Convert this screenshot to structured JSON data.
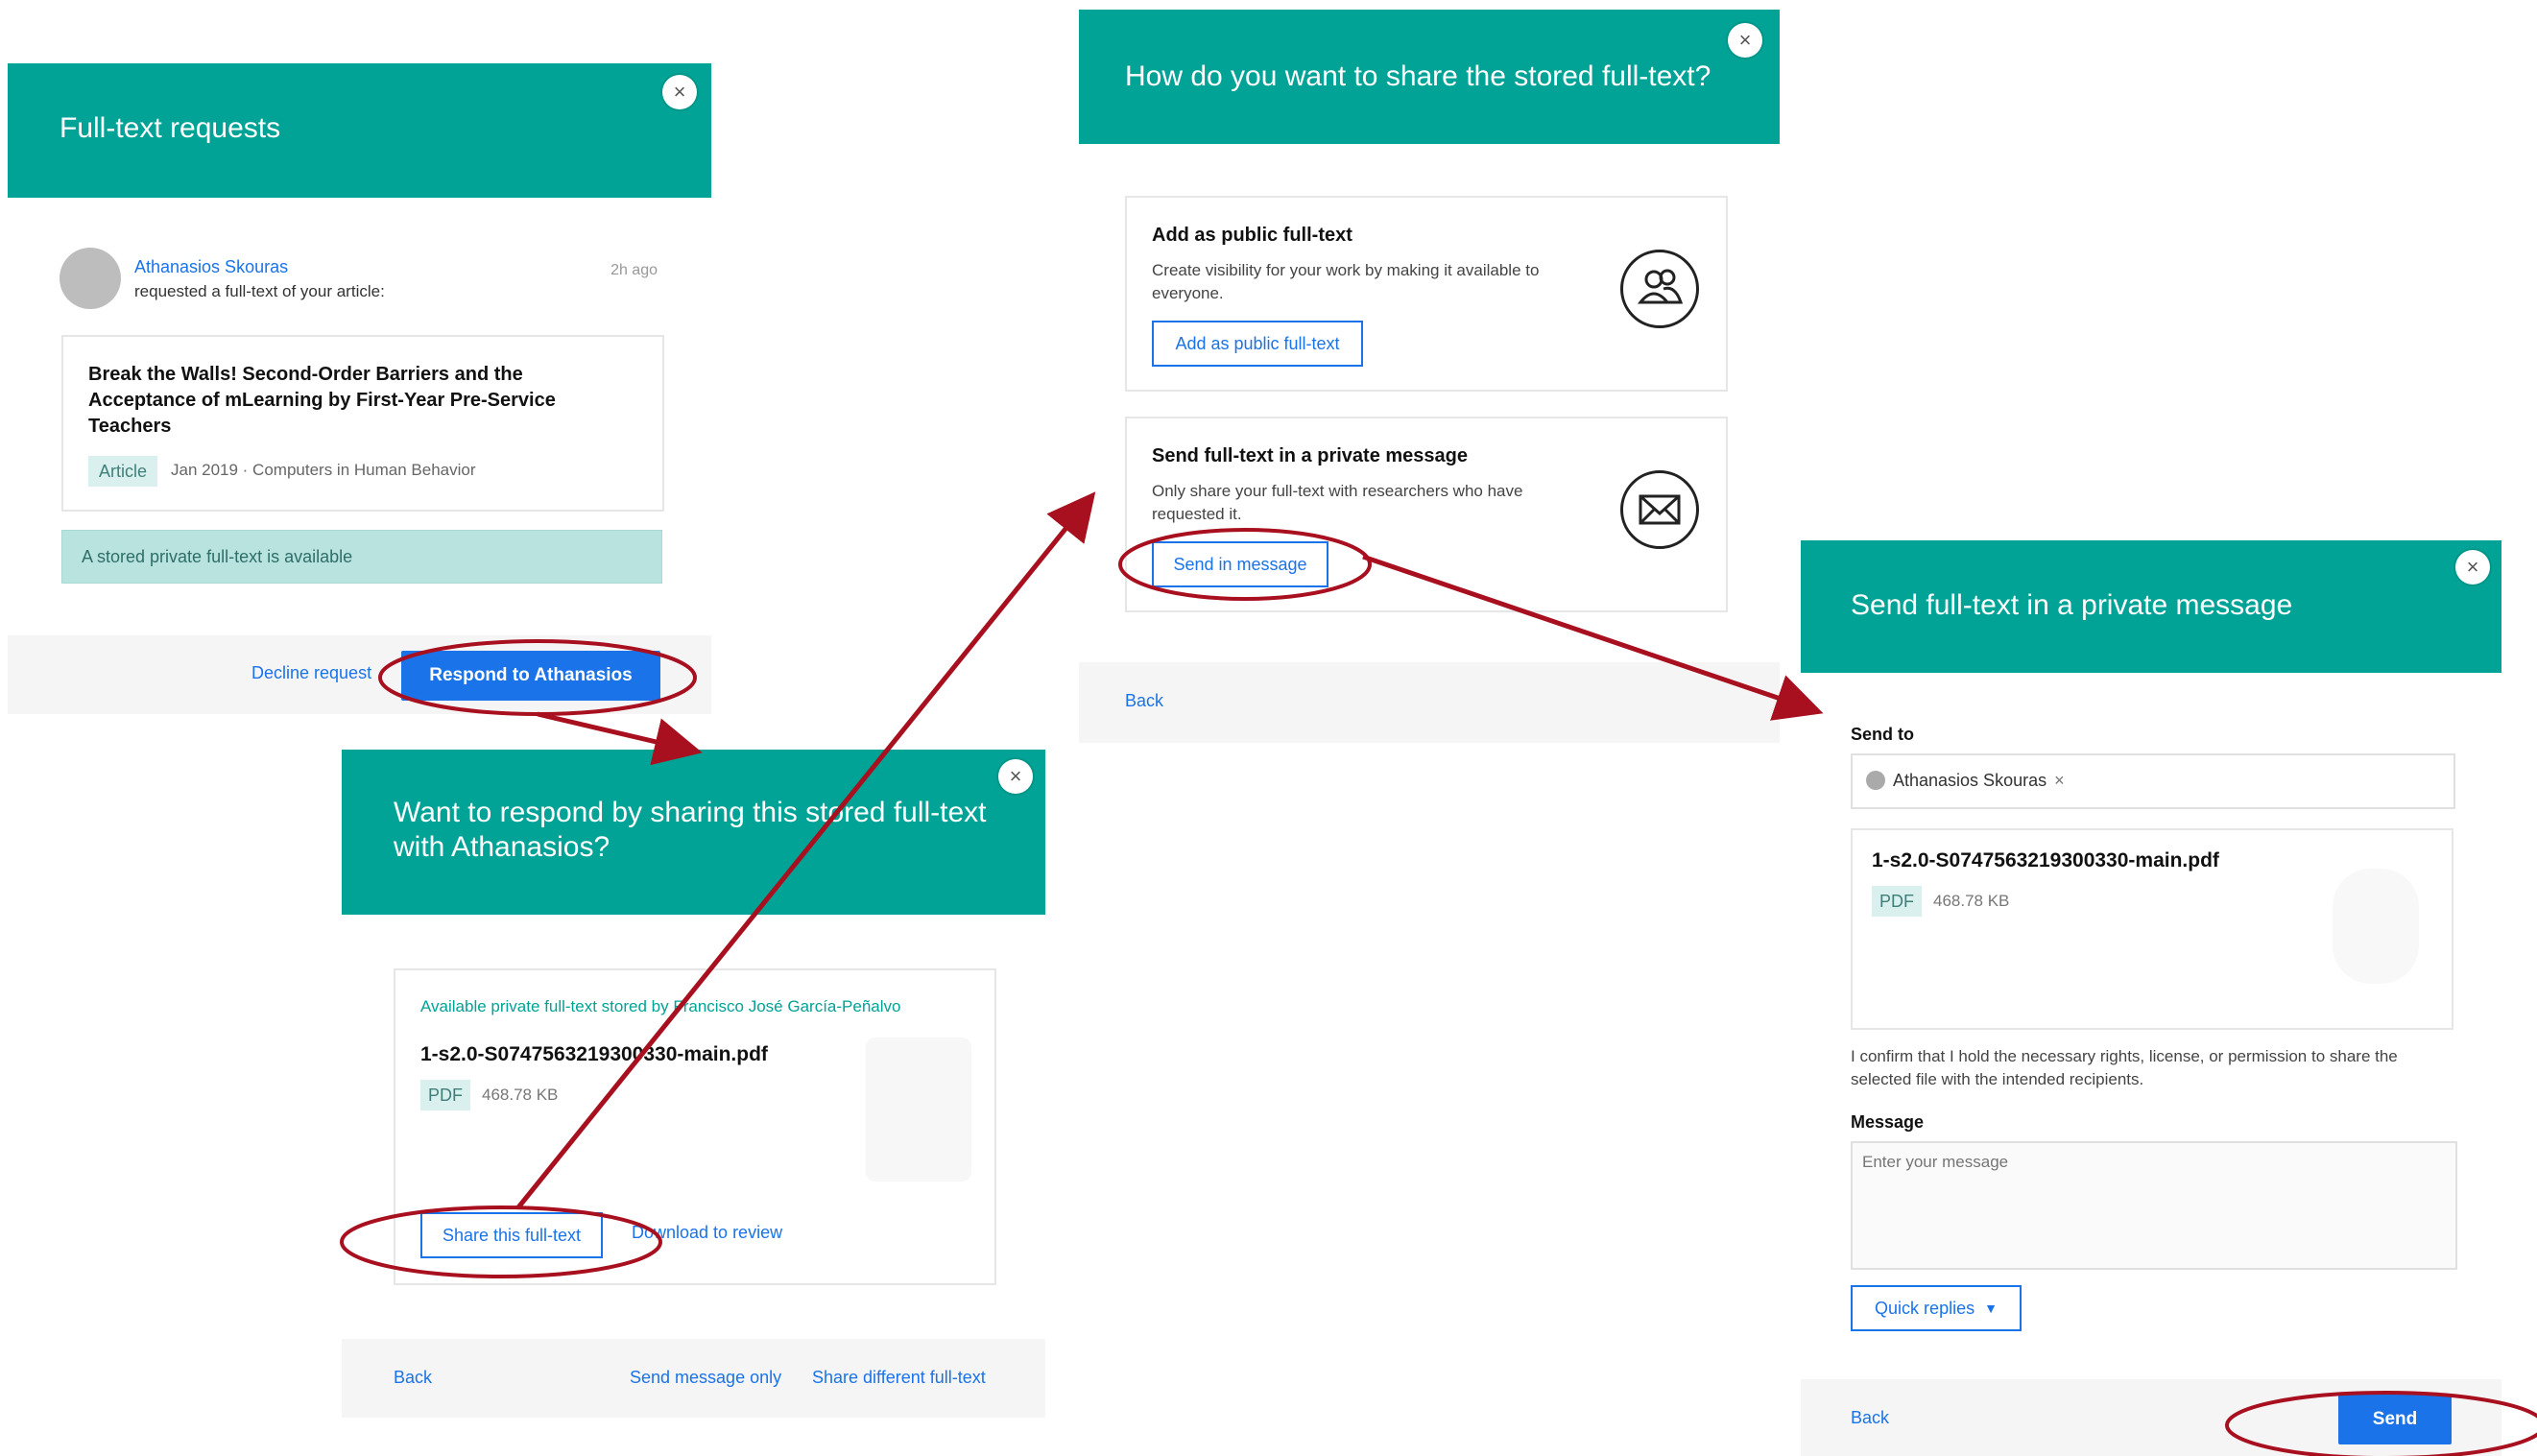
{
  "panel1": {
    "title": "Full-text requests",
    "requester_name": "Athanasios Skouras",
    "request_text": "requested a full-text of your article:",
    "time_ago": "2h ago",
    "article_title": "Break the Walls! Second-Order Barriers and the Acceptance of mLearning by First-Year Pre-Service Teachers",
    "article_badge": "Article",
    "article_meta": "Jan 2019 · Computers in Human Behavior",
    "notice": "A stored private full-text is available",
    "decline_label": "Decline request",
    "respond_label": "Respond to Athanasios"
  },
  "panel2": {
    "title": "Want to respond by sharing this stored full-text with Athanasios?",
    "stored_by": "Available private full-text stored by Francisco José García-Peñalvo",
    "filename": "1-s2.0-S0747563219300330-main.pdf",
    "file_type": "PDF",
    "file_size": "468.78 KB",
    "share_label": "Share this full-text",
    "download_label": "Download to review",
    "back_label": "Back",
    "send_message_only_label": "Send message only",
    "share_different_label": "Share different full-text"
  },
  "panel3": {
    "title": "How do you want to share the stored full-text?",
    "option_public_title": "Add as public full-text",
    "option_public_desc": "Create visibility for your work by making it available to everyone.",
    "option_public_button": "Add as public full-text",
    "option_private_title": "Send full-text in a private message",
    "option_private_desc": "Only share your full-text with researchers who have requested it.",
    "option_private_button": "Send in message",
    "back_label": "Back"
  },
  "panel4": {
    "title": "Send full-text in a private message",
    "send_to_label": "Send to",
    "recipient_chip": "Athanasios Skouras",
    "filename": "1-s2.0-S0747563219300330-main.pdf",
    "file_type": "PDF",
    "file_size": "468.78 KB",
    "confirm_text": "I confirm that I hold the necessary rights, license, or permission to share the selected file with the intended recipients.",
    "message_label": "Message",
    "message_placeholder": "Enter your message",
    "quick_replies_label": "Quick replies",
    "back_label": "Back",
    "send_label": "Send"
  },
  "icons": {
    "close": "close-icon",
    "public": "people-icon",
    "private": "envelope-icon",
    "chevron": "chevron-down-icon"
  },
  "colors": {
    "header_teal": "#00a396",
    "link_blue": "#1a73e8",
    "annotation_red": "#a8101f"
  }
}
